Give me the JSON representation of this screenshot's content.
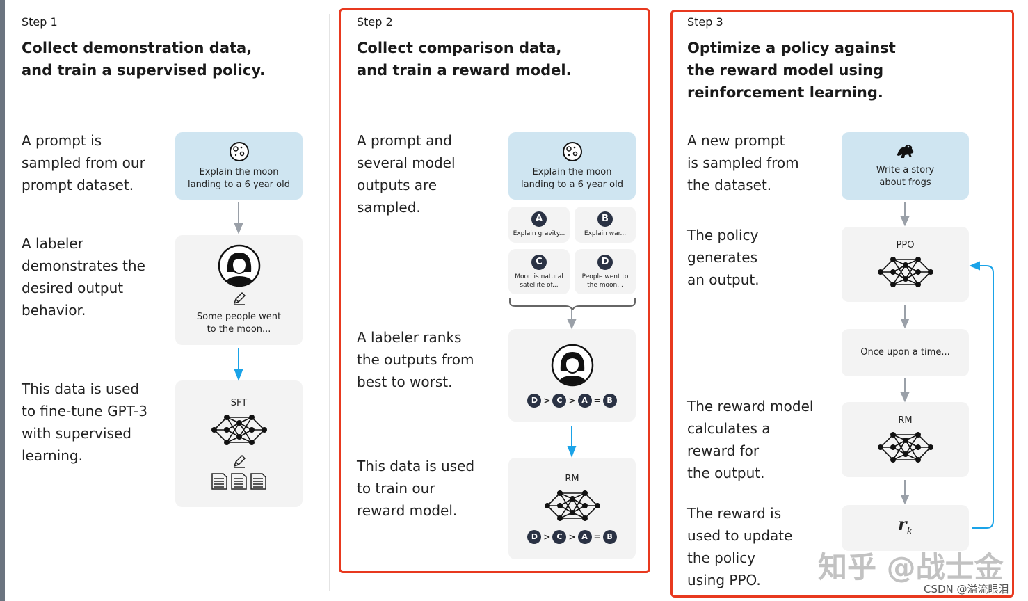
{
  "steps": [
    {
      "step": "Step 1",
      "title": [
        "Collect demonstration data,",
        "and train a supervised policy."
      ],
      "desc": [
        [
          "A prompt is",
          "sampled from our",
          "prompt dataset."
        ],
        [
          "A labeler",
          "demonstrates the",
          "desired output",
          "behavior."
        ],
        [
          "This data is used",
          "to fine-tune GPT-3",
          "with supervised",
          "learning."
        ]
      ],
      "prompt": [
        "Explain the moon",
        "landing to a 6 year old"
      ],
      "prompt_icon": "moon-icon",
      "labeler_output": [
        "Some people went",
        "to the moon..."
      ],
      "model_label": "SFT"
    },
    {
      "step": "Step 2",
      "title": [
        "Collect comparison data,",
        "and train a reward model."
      ],
      "desc": [
        [
          "A prompt and",
          "several model",
          "outputs are",
          "sampled."
        ],
        [
          "A labeler ranks",
          "the outputs from",
          "best to worst."
        ],
        [
          "This data is used",
          "to train our",
          "reward model."
        ]
      ],
      "prompt": [
        "Explain the moon",
        "landing to a 6 year old"
      ],
      "prompt_icon": "moon-icon",
      "outputs": [
        {
          "id": "A",
          "text": [
            "Explain gravity..."
          ]
        },
        {
          "id": "B",
          "text": [
            "Explain war..."
          ]
        },
        {
          "id": "C",
          "text": [
            "Moon is natural",
            "satellite of..."
          ]
        },
        {
          "id": "D",
          "text": [
            "People went to",
            "the moon..."
          ]
        }
      ],
      "ranking": [
        "D",
        ">",
        "C",
        ">",
        "A",
        "=",
        "B"
      ],
      "model_label": "RM"
    },
    {
      "step": "Step 3",
      "title": [
        "Optimize a policy against",
        "the reward model using",
        "reinforcement learning."
      ],
      "desc": [
        [
          "A new prompt",
          "is sampled from",
          "the dataset."
        ],
        [
          "The policy",
          "generates",
          "an output."
        ],
        [
          "The reward model",
          "calculates a",
          "reward for",
          "the output."
        ],
        [
          "The reward is",
          "used to update",
          "the policy",
          "using PPO."
        ]
      ],
      "prompt": [
        "Write a story",
        "about frogs"
      ],
      "prompt_icon": "frog-icon",
      "policy_label": "PPO",
      "output": "Once upon a time...",
      "model_label": "RM",
      "reward": "r",
      "reward_sub": "k"
    }
  ],
  "watermark": "知乎 @战士金",
  "credit": "CSDN @溢流眼泪",
  "colors": {
    "highlight_frame": "#e8391f",
    "prompt_box": "#cfe5f1",
    "box": "#f3f3f3",
    "blue_arrow": "#1aa3e8",
    "gray_arrow": "#9aa0a8",
    "badge": "#2a3244"
  }
}
